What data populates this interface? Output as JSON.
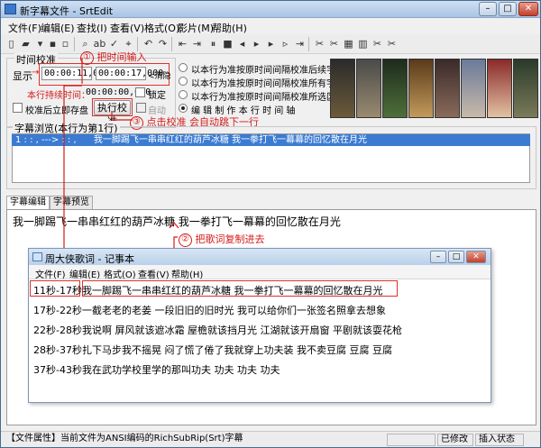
{
  "window": {
    "title": "新字幕文件 - SrtEdit",
    "minimize_glyph": "–",
    "maximize_glyph": "□",
    "close_glyph": "✕"
  },
  "menubar": [
    "文件(F)",
    "编辑(E)",
    "查找(I)",
    "查看(V)",
    "格式(O)",
    "影片(M)",
    "帮助(H)"
  ],
  "time_group": {
    "title": "时间校准",
    "display_label": "显示",
    "arrow_left": "→",
    "start_time": "00:00:11,000",
    "end_time": "00:00:17,000",
    "vanish_label": "<消隐",
    "duration_label": "本行持续时间：",
    "duration_value": "00:00:00,000",
    "lock_label": "锁定",
    "save_after_calibrate_label": "校准后立即存盘",
    "execute_button": "执行校准",
    "auto_label": "自动"
  },
  "callouts": {
    "c1_num": "①",
    "c1_text": "把时间输入",
    "c2_num": "②",
    "c2_text": "把歌词复制进去",
    "c3_num": "③",
    "c3_text": "点击校准 会自动跳下一行"
  },
  "radio_options": [
    {
      "label": "以本行为准按原时间间隔校准后续字幕",
      "selected": false
    },
    {
      "label": "以本行为准按原时间间隔校准所有字幕",
      "selected": false
    },
    {
      "label": "以本行为准按原时间间隔校准所选区间",
      "selected": false
    },
    {
      "label": "编 辑 制 作 本 行 时 间 轴",
      "selected": true
    }
  ],
  "browse": {
    "title": "字幕浏览(本行为第1行)",
    "row_prefix": "1    :    :   ,   --->   :    :   ,",
    "row_text": "我一脚踢飞一串串红红的葫芦冰糖 我一拳打飞一幕幕的回忆散在月光"
  },
  "tabs": [
    "字幕编辑",
    "字幕预览"
  ],
  "edit_text": "我一脚踢飞一串串红红的葫芦冰糖 我一拳打飞一幕幕的回忆散在月光",
  "notepad": {
    "title": "周大侠歌词 - 记事本",
    "menu": [
      "文件(F)",
      "编辑(E)",
      "格式(O)",
      "查看(V)",
      "帮助(H)"
    ],
    "lines": [
      {
        "time": "11秒-17秒",
        "text": "我一脚踢飞一串串红红的葫芦冰糖 我一拳打飞一幕幕的回忆散在月光"
      },
      {
        "time": "17秒-22秒",
        "text": "一截老老的老姜 一段旧旧的旧时光 我可以给你们一张签名照拿去想象"
      },
      {
        "time": "22秒-28秒",
        "text": "我说啊 屏风就该遮冰霜 屋檐就该挡月光 江湖就该开扇窗 平剧就该耍花枪"
      },
      {
        "time": "28秒-37秒",
        "text": "扎下马步我不摇晃 闷了慌了倦了我就穿上功夫装 我不卖豆腐 豆腐 豆腐"
      },
      {
        "time": "37秒-43秒",
        "text": "我在武功学校里学的那叫功夫 功夫 功夫 功夫"
      }
    ]
  },
  "statusbar": {
    "info": "【文件属性】当前文件为ANSI编码的RichSubRip(Srt)字幕",
    "cell1": "",
    "modified": "已修改",
    "insert": "插入状态"
  },
  "colors": {
    "annotation_red": "#d41b1b",
    "selection_blue": "#3b7bd2"
  }
}
